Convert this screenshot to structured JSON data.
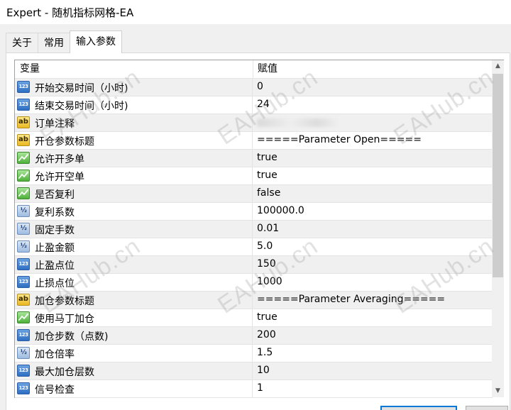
{
  "window": {
    "title": "Expert - 随机指标网格-EA"
  },
  "tabs": [
    {
      "label": "关于",
      "active": false
    },
    {
      "label": "常用",
      "active": false
    },
    {
      "label": "输入参数",
      "active": true
    }
  ],
  "table": {
    "headers": {
      "variable": "变量",
      "value": "赋值"
    },
    "rows": [
      {
        "type": "int",
        "icon": "int-type-icon",
        "icon_text": "123",
        "name": "开始交易时间（小时)",
        "value": "0"
      },
      {
        "type": "int",
        "icon": "int-type-icon",
        "icon_text": "123",
        "name": "结束交易时间（小时)",
        "value": "24"
      },
      {
        "type": "string",
        "icon": "string-type-icon",
        "icon_text": "ab",
        "name": "订单注释",
        "value": "",
        "redacted": true
      },
      {
        "type": "string",
        "icon": "string-type-icon",
        "icon_text": "ab",
        "name": "开仓参数标题",
        "value": "=====Parameter Open====="
      },
      {
        "type": "bool",
        "icon": "bool-type-icon",
        "icon_text": "",
        "name": "允许开多单",
        "value": "true"
      },
      {
        "type": "bool",
        "icon": "bool-type-icon",
        "icon_text": "",
        "name": "允许开空单",
        "value": "true"
      },
      {
        "type": "bool",
        "icon": "bool-type-icon",
        "icon_text": "",
        "name": "是否复利",
        "value": "false"
      },
      {
        "type": "double",
        "icon": "double-type-icon",
        "icon_text": "½",
        "name": "复利系数",
        "value": "100000.0"
      },
      {
        "type": "double",
        "icon": "double-type-icon",
        "icon_text": "½",
        "name": "固定手数",
        "value": "0.01"
      },
      {
        "type": "double",
        "icon": "double-type-icon",
        "icon_text": "½",
        "name": "止盈金额",
        "value": "5.0"
      },
      {
        "type": "int",
        "icon": "int-type-icon",
        "icon_text": "123",
        "name": "止盈点位",
        "value": "150"
      },
      {
        "type": "int",
        "icon": "int-type-icon",
        "icon_text": "123",
        "name": "止损点位",
        "value": "1000"
      },
      {
        "type": "string",
        "icon": "string-type-icon",
        "icon_text": "ab",
        "name": "加仓参数标题",
        "value": "=====Parameter Averaging====="
      },
      {
        "type": "bool",
        "icon": "bool-type-icon",
        "icon_text": "",
        "name": "使用马丁加仓",
        "value": "true"
      },
      {
        "type": "int",
        "icon": "int-type-icon",
        "icon_text": "123",
        "name": "加仓步数（点数)",
        "value": "200"
      },
      {
        "type": "double",
        "icon": "double-type-icon",
        "icon_text": "½",
        "name": "加仓倍率",
        "value": "1.5"
      },
      {
        "type": "int",
        "icon": "int-type-icon",
        "icon_text": "123",
        "name": "最大加仓层数",
        "value": "10"
      },
      {
        "type": "int",
        "icon": "int-type-icon",
        "icon_text": "123",
        "name": "信号检查",
        "value": "1"
      }
    ]
  },
  "watermark": {
    "text": "EAHub.cn"
  }
}
